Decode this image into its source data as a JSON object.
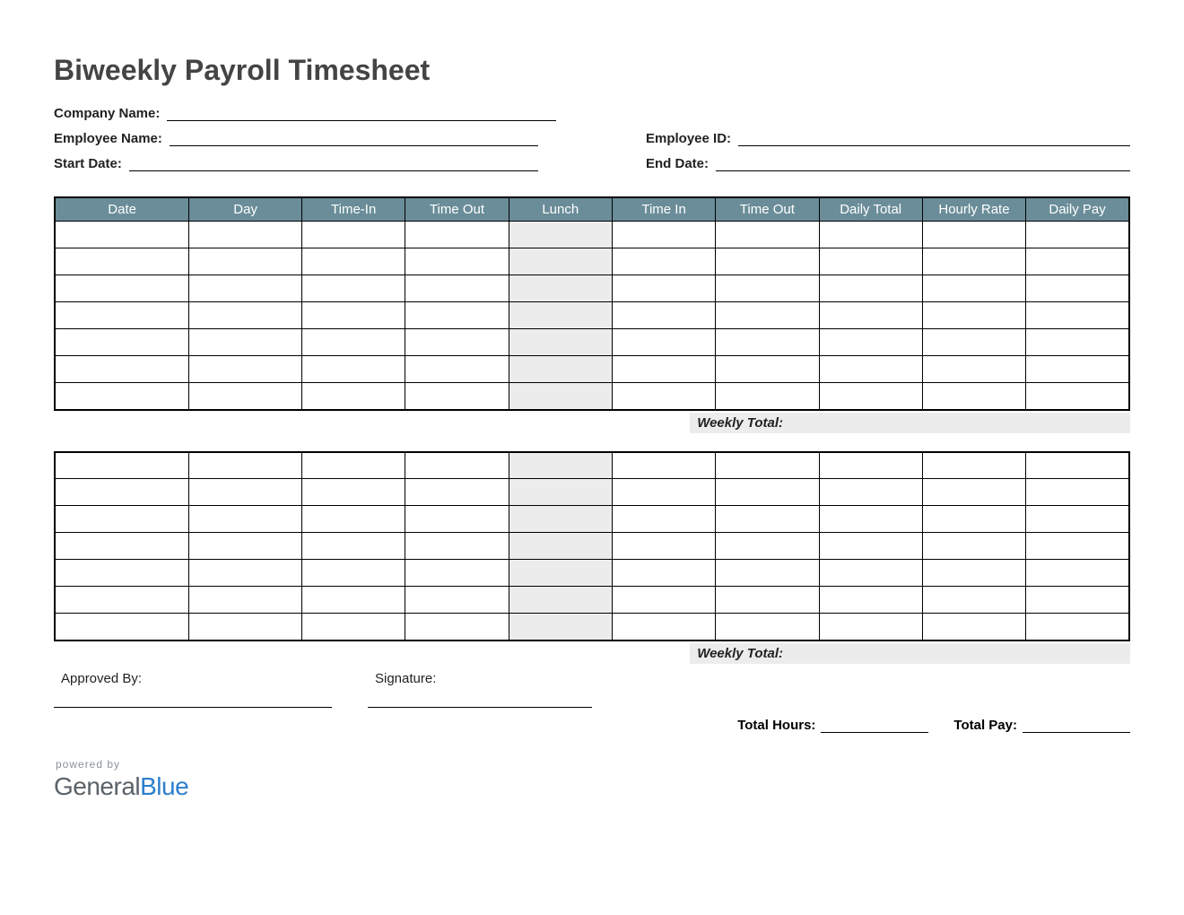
{
  "title": "Biweekly Payroll Timesheet",
  "fields": {
    "company_name_label": "Company Name:",
    "employee_name_label": "Employee Name:",
    "employee_id_label": "Employee ID:",
    "start_date_label": "Start Date:",
    "end_date_label": "End Date:"
  },
  "columns": {
    "date": "Date",
    "day": "Day",
    "time_in1": "Time-In",
    "time_out1": "Time Out",
    "lunch": "Lunch",
    "time_in2": "Time In",
    "time_out2": "Time Out",
    "daily_total": "Daily Total",
    "hourly_rate": "Hourly Rate",
    "daily_pay": "Daily Pay"
  },
  "week1_rows": 7,
  "week2_rows": 7,
  "weekly_total_label": "Weekly Total:",
  "footer": {
    "approved_by_label": "Approved By:",
    "signature_label": "Signature:",
    "total_hours_label": "Total Hours:",
    "total_pay_label": "Total Pay:"
  },
  "logo": {
    "powered_by": "powered by",
    "name_part1": "General",
    "name_part2": "Blue"
  }
}
